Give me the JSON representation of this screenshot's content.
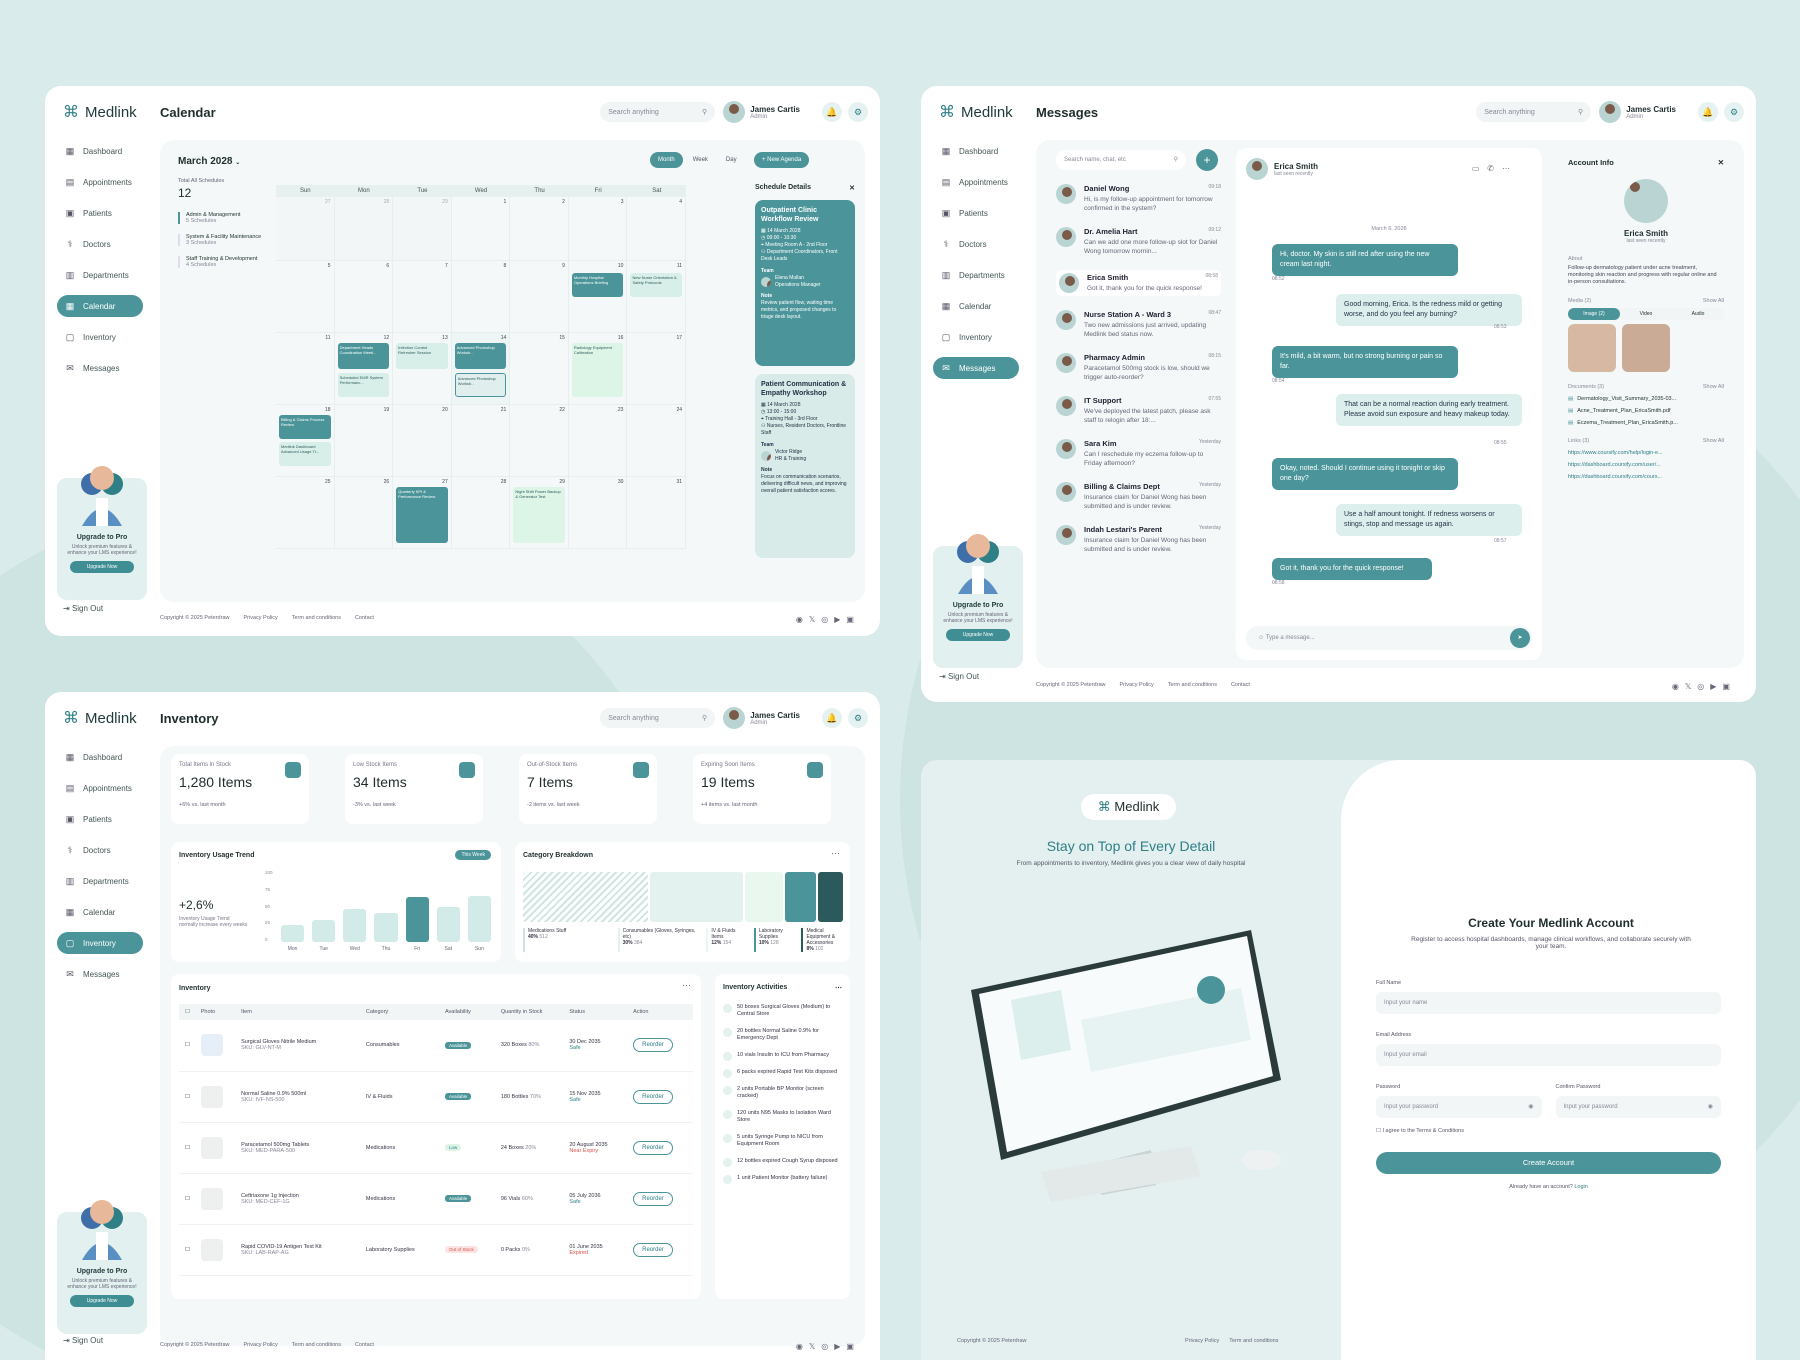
{
  "brand": "Medlink",
  "search_placeholder": "Search anything",
  "user": {
    "name": "James Cartis",
    "role": "Admin"
  },
  "nav": [
    "Dashboard",
    "Appointments",
    "Patients",
    "Doctors",
    "Departments",
    "Calendar",
    "Inventory",
    "Messages"
  ],
  "upgrade": {
    "title": "Upgrade to Pro",
    "text": "Unlock premium features & enhance your LMS experience!",
    "button": "Upgrade Now"
  },
  "signout": "Sign Out",
  "footer": {
    "copyright": "Copyright © 2025 Peterdraw",
    "privacy": "Privacy Policy",
    "terms": "Term and conditions",
    "contact": "Contact"
  },
  "calendar": {
    "title": "Calendar",
    "month": "March 2028",
    "views": [
      "Month",
      "Week",
      "Day"
    ],
    "new_agenda": "+ New Agenda",
    "total_label": "Total All Schedules",
    "total": "12",
    "categories": [
      {
        "name": "Admin & Management",
        "count": "5 Schedules"
      },
      {
        "name": "System & Facility Maintenance",
        "count": "3 Schedules"
      },
      {
        "name": "Staff Training & Development",
        "count": "4 Schedules"
      }
    ],
    "days": [
      "Sun",
      "Mon",
      "Tue",
      "Wed",
      "Thu",
      "Fri",
      "Sat"
    ],
    "weeks": [
      [
        "26",
        "27",
        "28",
        "29",
        "1",
        "2",
        "3",
        "4"
      ],
      [
        "5",
        "6",
        "7",
        "8",
        "9",
        "10",
        "11"
      ],
      [
        "11",
        "12",
        "13",
        "14",
        "15",
        "16",
        "17"
      ],
      [
        "18",
        "19",
        "20",
        "21",
        "22",
        "23",
        "24"
      ],
      [
        "25",
        "26",
        "27",
        "28",
        "29",
        "30",
        "31"
      ]
    ],
    "events": {
      "e1": "Monthly Hospital Operations Briefing",
      "e2": "New Nurse Orientation & Safety Protocols",
      "e3": "Department Heads Coordination Meeti...",
      "e4": "Scheduled EMR System Performanc...",
      "e5": "Infection Control Refresher Session",
      "e6": "Advanced Photoshop Worksh...",
      "e7": "Advanced Photoshop Worksh...",
      "e8": "Radiology Equipment Calibration",
      "e9": "Billing & Claims Process Review",
      "e10": "Medlink Dashboard Advanced Usage Tr...",
      "e11": "Quarterly KPI & Performance Review",
      "e12": "Night Shift Power Backup & Generator Test"
    },
    "details": {
      "title": "Schedule Details",
      "c1": {
        "title": "Outpatient Clinic Workflow Review",
        "date": "14 March 2028",
        "time": "09:00 - 10:30",
        "place": "Meeting Room A - 2nd Floor",
        "who": "Department Coordinators, Front Desk Leads",
        "team": "Team",
        "member": "Elena Mullan",
        "member_role": "Operations Manager",
        "note_h": "Note",
        "note": "Review patient flow, waiting time metrics, and proposed changes to triage desk layout."
      },
      "c2": {
        "title": "Patient Communication & Empathy Workshop",
        "date": "14 March 2028",
        "time": "13:00 - 15:00",
        "place": "Training Hall - 3rd Floor",
        "who": "Nurses, Resident Doctors, Frontline Staff",
        "team": "Team",
        "member": "Victor Ridge",
        "member_role": "HR & Training",
        "note_h": "Note",
        "note": "Focus on communication scenarios, delivering difficult news, and improving overall patient satisfaction scores."
      }
    }
  },
  "messages": {
    "title": "Messages",
    "search": "Search name, chat, etc",
    "list": [
      {
        "name": "Daniel Wong",
        "time": "09:18",
        "text": "Hi, is my follow-up appointment for tomorrow confirmed in the system?"
      },
      {
        "name": "Dr. Amelia Hart",
        "time": "09:12",
        "text": "Can we add one more follow-up slot for Daniel Wong tomorrow mornin..."
      },
      {
        "name": "Erica Smith",
        "time": "08:58",
        "text": "Got it, thank you for the quick response!"
      },
      {
        "name": "Nurse Station A - Ward 3",
        "time": "08:47",
        "text": "Two new admissions just arrived, updating Medlink bed status now."
      },
      {
        "name": "Pharmacy Admin",
        "time": "08:15",
        "text": "Paracetamol 500mg stock is low, should we trigger auto-reorder?"
      },
      {
        "name": "IT Support",
        "time": "07:55",
        "text": "We've deployed the latest patch, please ask staff to relogin after 18:..."
      },
      {
        "name": "Sara Kim",
        "time": "Yesterday",
        "text": "Can I reschedule my eczema follow-up to Friday afternoon?"
      },
      {
        "name": "Billing & Claims Dept",
        "time": "Yesterday",
        "text": "Insurance claim for Daniel Wong has been submitted and is under review."
      },
      {
        "name": "Indah Lestari's Parent",
        "time": "Yesterday",
        "text": "Insurance claim for Daniel Wong has been submitted and is under review."
      }
    ],
    "chat": {
      "name": "Erica Smith",
      "status": "last seen recently",
      "date": "March 6, 2028",
      "placeholder": "Type a message...",
      "bubbles": [
        {
          "t": "Hi, doctor. My skin is still red after using the new cream last night.",
          "time": "08:52"
        },
        {
          "t": "Good morning, Erica. Is the redness mild or getting worse, and do you feel any burning?",
          "time": "08:53"
        },
        {
          "t": "It's mild, a bit warm, but no strong burning or pain so far.",
          "time": "08:54"
        },
        {
          "t": "That can be a normal reaction during early treatment. Please avoid sun exposure and heavy makeup today.",
          "time": "08:55"
        },
        {
          "t": "Okay, noted. Should I continue using it tonight or skip one day?",
          "time": "08:56"
        },
        {
          "t": "Use a half amount tonight. If redness worsens or stings, stop and message us again.",
          "time": "08:57"
        },
        {
          "t": "Got it, thank you for the quick response!",
          "time": "08:58"
        }
      ]
    },
    "account": {
      "title": "Account Info",
      "name": "Erica Smith",
      "status": "last seen recently",
      "about_h": "About",
      "about": "Follow-up dermatology patient under acne treatment, monitoring skin reaction and progress with regular online and in-person consultations.",
      "media_h": "Media (2)",
      "show_all": "Show All",
      "tabs": [
        "Image (2)",
        "Video",
        "Audio"
      ],
      "docs_h": "Documents (3)",
      "docs": [
        "Dermatology_Visit_Summary_2035-03...",
        "Acne_Treatment_Plan_EricaSmith.pdf",
        "Eczema_Treatment_Plan_EricaSmith.p..."
      ],
      "links_h": "Links (3)",
      "links": [
        "https://www.coursify.com/help/login-e...",
        "https://dashboard.coursify.com/user/...",
        "https://dashboard.coursify.com/cours..."
      ]
    }
  },
  "inventory": {
    "title": "Inventory",
    "stats": [
      {
        "label": "Total Items in Stock",
        "value": "1,280 Items",
        "sub": "+6% vs. last month"
      },
      {
        "label": "Low Stock Items",
        "value": "34 Items",
        "sub": "-3% vs. last week"
      },
      {
        "label": "Out-of-Stock Items",
        "value": "7 Items",
        "sub": "-2 items vs. last week"
      },
      {
        "label": "Expiring Soon Items",
        "value": "19 Items",
        "sub": "+4 items vs. last month"
      }
    ],
    "trend": {
      "title": "Inventory Usage Trend",
      "range": "This Week",
      "value": "+2,6%",
      "note": "Inventory Usage Trend normally increase every weeks",
      "days": [
        "Mon",
        "Tue",
        "Wed",
        "Thu",
        "Fri",
        "Sat",
        "Sun"
      ],
      "yticks": [
        "100",
        "75",
        "50",
        "25",
        "0"
      ]
    },
    "breakdown": {
      "title": "Category Breakdown",
      "cats": [
        {
          "n": "Medications Stuff",
          "p": "40%",
          "c": "512"
        },
        {
          "n": "Consumables (Gloves, Syringes, etc)",
          "p": "30%",
          "c": "384"
        },
        {
          "n": "IV & Fluids Items",
          "p": "12%",
          "c": "154"
        },
        {
          "n": "Laboratory Supplies",
          "p": "10%",
          "c": "128"
        },
        {
          "n": "Medical Equipment & Accessories",
          "p": "8%",
          "c": "102"
        }
      ]
    },
    "table": {
      "title": "Inventory",
      "headers": [
        "Photo",
        "Item",
        "Category",
        "Availability",
        "Quantity in Stock",
        "Status",
        "Action"
      ],
      "rows": [
        {
          "item": "Surgical Gloves Nitrile Medium",
          "sku": "SKU: GLV-NT-M",
          "cat": "Consumables",
          "avail": "Available",
          "qty": "320 Boxes",
          "pct": "80%",
          "date": "30 Dec 2035",
          "st": "Safe"
        },
        {
          "item": "Normal Saline 0.9% 500ml",
          "sku": "SKU: IVF-NS-500",
          "cat": "IV & Fluids",
          "avail": "Available",
          "qty": "180 Bottles",
          "pct": "70%",
          "date": "15 Nov 2035",
          "st": "Safe"
        },
        {
          "item": "Paracetamol 500mg Tablets",
          "sku": "SKU: MED-PARA-500",
          "cat": "Medications",
          "avail": "Low",
          "qty": "24 Boxes",
          "pct": "20%",
          "date": "20 August 2035",
          "st": "Near Expiry"
        },
        {
          "item": "Ceftriaxone 1g Injection",
          "sku": "SKU: MED-CEF-1G",
          "cat": "Medications",
          "avail": "Available",
          "qty": "96 Vials",
          "pct": "60%",
          "date": "05 July 2036",
          "st": "Safe"
        },
        {
          "item": "Rapid COVID-19 Antigen Test Kit",
          "sku": "SKU: LAB-RAP-AG",
          "cat": "Laboratory Supplies",
          "avail": "Out of Stock",
          "qty": "0 Packs",
          "pct": "0%",
          "date": "01 June 2035",
          "st": "Expired"
        }
      ],
      "reorder": "Reorder"
    },
    "activities": {
      "title": "Inventory Activities",
      "items": [
        "50 boxes Surgical Gloves (Medium) to Central Store",
        "20 bottles Normal Saline 0.9% for Emergency Dept",
        "10 vials Insulin to ICU from Pharmacy",
        "6 packs expired Rapid Test Kits disposed",
        "2 units Portable BP Monitor (screen cracked)",
        "120 units N95 Masks to Isolation Ward Store",
        "5 units Syringe Pump to NICU from Equipment Room",
        "12 bottles expired Cough Syrup disposed",
        "1 unit Patient Monitor (battery failure)"
      ]
    }
  },
  "register": {
    "tagline": "Stay on Top of Every Detail",
    "sub": "From appointments to inventory, Medlink gives you a clear view of daily hospital",
    "title": "Create Your Medlink Account",
    "desc": "Register to access hospital dashboards, manage clinical workflows, and collaborate securely with your team.",
    "full_name": "Full Name",
    "full_name_ph": "Input your name",
    "email": "Email Address",
    "email_ph": "Input your email",
    "password": "Password",
    "password_ph": "Input your password",
    "confirm": "Confirm Password",
    "confirm_ph": "Input your password",
    "agree": "I agree to the Terms & Conditions",
    "button": "Create Account",
    "login_q": "Already have an account?",
    "login": "Login",
    "copyright": "Copyright © 2025 Peterdraw",
    "privacy": "Privacy Policy",
    "terms": "Term and conditions"
  },
  "colors": {
    "accent": "#4b959a",
    "background": "#d9ebea"
  }
}
